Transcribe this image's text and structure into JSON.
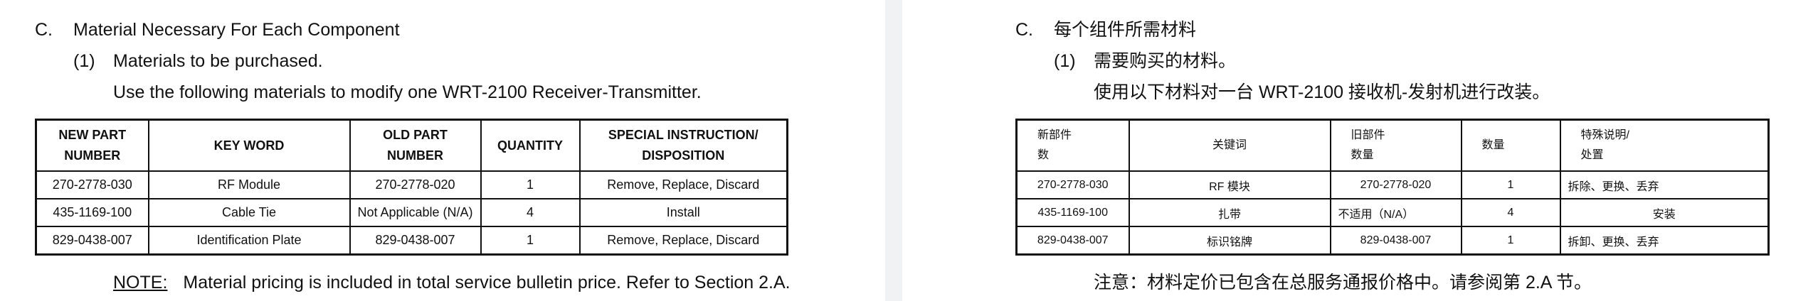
{
  "english": {
    "section_letter": "C.",
    "section_title": "Material Necessary For Each Component",
    "sub_number": "(1)",
    "sub_title": "Materials to be purchased.",
    "instruction": "Use the following materials to modify one WRT-2100 Receiver-Transmitter.",
    "headers": {
      "new_part_1": "NEW PART",
      "new_part_2": "NUMBER",
      "key_word": "KEY WORD",
      "old_part_1": "OLD PART",
      "old_part_2": "NUMBER",
      "quantity": "QUANTITY",
      "special_1": "SPECIAL INSTRUCTION/",
      "special_2": "DISPOSITION"
    },
    "rows": [
      {
        "new_part": "270-2778-030",
        "key_word": "RF Module",
        "old_part": "270-2778-020",
        "quantity": "1",
        "disposition": "Remove, Replace, Discard"
      },
      {
        "new_part": "435-1169-100",
        "key_word": "Cable Tie",
        "old_part": "Not Applicable (N/A)",
        "quantity": "4",
        "disposition": "Install"
      },
      {
        "new_part": "829-0438-007",
        "key_word": "Identification Plate",
        "old_part": "829-0438-007",
        "quantity": "1",
        "disposition": "Remove, Replace, Discard"
      }
    ],
    "note_label": "NOTE:",
    "note_text": "Material pricing is included in total service bulletin price.  Refer to Section 2.A."
  },
  "chinese": {
    "section_letter": "C.",
    "section_title": "每个组件所需材料",
    "sub_number": "(1)",
    "sub_title": "需要购买的材料。",
    "instruction": "使用以下材料对一台 WRT-2100 接收机-发射机进行改装。",
    "headers": {
      "new_part_1": "新部件",
      "new_part_2": "数",
      "key_word": "关键词",
      "old_part_1": "旧部件",
      "old_part_2": "数量",
      "quantity": "数量",
      "special_1": "特殊说明/",
      "special_2": "处置"
    },
    "rows": [
      {
        "new_part": "270-2778-030",
        "key_word": "RF 模块",
        "old_part": "270-2778-020",
        "quantity": "1",
        "disposition": "拆除、更换、丢弃"
      },
      {
        "new_part": "435-1169-100",
        "key_word": "扎带",
        "old_part": "不适用（N/A）",
        "quantity": "4",
        "disposition": "安装"
      },
      {
        "new_part": "829-0438-007",
        "key_word": "标识铭牌",
        "old_part": "829-0438-007",
        "quantity": "1",
        "disposition": "拆卸、更换、丢弃"
      }
    ],
    "note_text": "注意：材料定价已包含在总服务通报价格中。请参阅第 2.A 节。"
  }
}
